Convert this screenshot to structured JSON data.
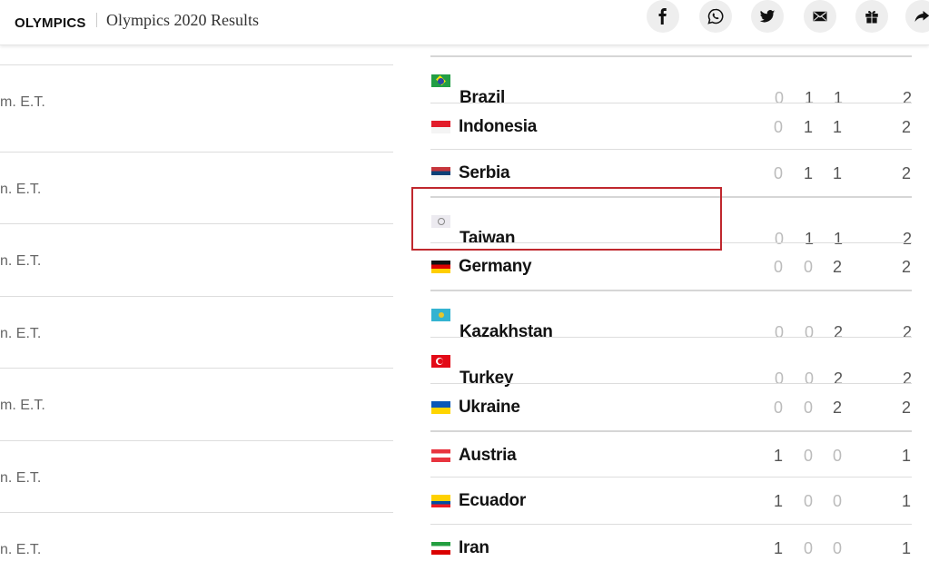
{
  "header": {
    "section": "OLYMPICS",
    "title": "Olympics 2020 Results",
    "share": [
      {
        "icon": "facebook-icon"
      },
      {
        "icon": "whatsapp-icon"
      },
      {
        "icon": "twitter-icon"
      },
      {
        "icon": "email-icon"
      },
      {
        "icon": "gift-icon"
      },
      {
        "icon": "share-icon"
      }
    ]
  },
  "left_times": [
    "m. E.T.",
    "n. E.T.",
    "n. E.T.",
    "n. E.T.",
    "m. E.T.",
    "n. E.T.",
    "n. E.T."
  ],
  "medal_table": [
    {
      "country": "Brazil",
      "flag": "brazil",
      "gold": "0",
      "silver": "1",
      "bronze": "1",
      "total": "2"
    },
    {
      "country": "Indonesia",
      "flag": "indonesia",
      "gold": "0",
      "silver": "1",
      "bronze": "1",
      "total": "2"
    },
    {
      "country": "Serbia",
      "flag": "serbia",
      "gold": "0",
      "silver": "1",
      "bronze": "1",
      "total": "2"
    },
    {
      "country": "Taiwan",
      "flag": "taiwan",
      "gold": "0",
      "silver": "1",
      "bronze": "1",
      "total": "2"
    },
    {
      "country": "Germany",
      "flag": "germany",
      "gold": "0",
      "silver": "0",
      "bronze": "2",
      "total": "2"
    },
    {
      "country": "Kazakhstan",
      "flag": "kazakhstan",
      "gold": "0",
      "silver": "0",
      "bronze": "2",
      "total": "2"
    },
    {
      "country": "Turkey",
      "flag": "turkey",
      "gold": "0",
      "silver": "0",
      "bronze": "2",
      "total": "2"
    },
    {
      "country": "Ukraine",
      "flag": "ukraine",
      "gold": "0",
      "silver": "0",
      "bronze": "2",
      "total": "2"
    },
    {
      "country": "Austria",
      "flag": "austria",
      "gold": "1",
      "silver": "0",
      "bronze": "0",
      "total": "1"
    },
    {
      "country": "Ecuador",
      "flag": "ecuador",
      "gold": "1",
      "silver": "0",
      "bronze": "0",
      "total": "1"
    },
    {
      "country": "Iran",
      "flag": "iran",
      "gold": "1",
      "silver": "0",
      "bronze": "0",
      "total": "1"
    }
  ],
  "highlighted_country": "Taiwan",
  "colors": {
    "highlight": "#c0282e"
  }
}
